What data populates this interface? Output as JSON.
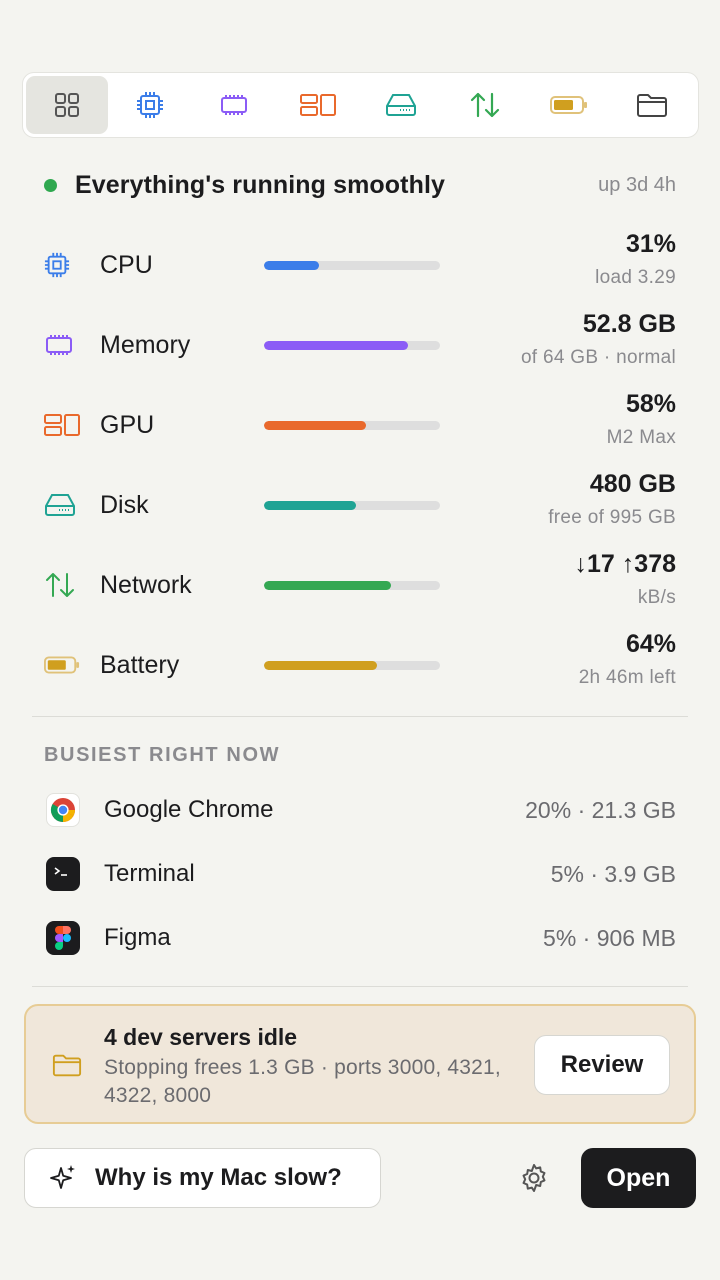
{
  "tabs": [
    {
      "icon": "grid-icon",
      "active": true
    },
    {
      "icon": "cpu-icon"
    },
    {
      "icon": "memory-icon"
    },
    {
      "icon": "gpu-icon"
    },
    {
      "icon": "disk-icon"
    },
    {
      "icon": "network-icon"
    },
    {
      "icon": "battery-icon"
    },
    {
      "icon": "folder-icon"
    }
  ],
  "status": {
    "text": "Everything's running smoothly",
    "uptime": "up 3d 4h",
    "color": "#2fa84f"
  },
  "metrics": [
    {
      "label": "CPU",
      "value": "31%",
      "sub": "load 3.29",
      "percent": 31,
      "color": "#3b7de9",
      "icon": "cpu-icon"
    },
    {
      "label": "Memory",
      "value": "52.8 GB",
      "sub": "of 64 GB · normal",
      "percent": 82,
      "color": "#8b5cf6",
      "icon": "memory-icon"
    },
    {
      "label": "GPU",
      "value": "58%",
      "sub": "M2 Max",
      "percent": 58,
      "color": "#e9692c",
      "icon": "gpu-icon"
    },
    {
      "label": "Disk",
      "value": "480 GB",
      "sub": "free of 995 GB",
      "percent": 52,
      "color": "#1fa394",
      "icon": "disk-icon"
    },
    {
      "label": "Network",
      "value": "↓17 ↑378",
      "sub": "kB/s",
      "percent": 72,
      "color": "#34a853",
      "icon": "network-icon"
    },
    {
      "label": "Battery",
      "value": "64%",
      "sub": "2h 46m left",
      "percent": 64,
      "color": "#d09f1f",
      "icon": "battery-icon"
    }
  ],
  "busiest": {
    "title": "BUSIEST RIGHT NOW",
    "items": [
      {
        "name": "Google Chrome",
        "stats": "20% · 21.3 GB",
        "icon": "chrome-icon"
      },
      {
        "name": "Terminal",
        "stats": "5% · 3.9 GB",
        "icon": "terminal-icon"
      },
      {
        "name": "Figma",
        "stats": "5% · 906 MB",
        "icon": "figma-icon"
      }
    ]
  },
  "banner": {
    "title": "4 dev servers idle",
    "description": "Stopping frees 1.3 GB · ports 3000, 4321, 4322, 8000",
    "action": "Review",
    "icon": "folder-icon"
  },
  "footer": {
    "ask_label": "Why is my Mac slow?",
    "open_label": "Open",
    "settings_icon": "gear-icon"
  }
}
